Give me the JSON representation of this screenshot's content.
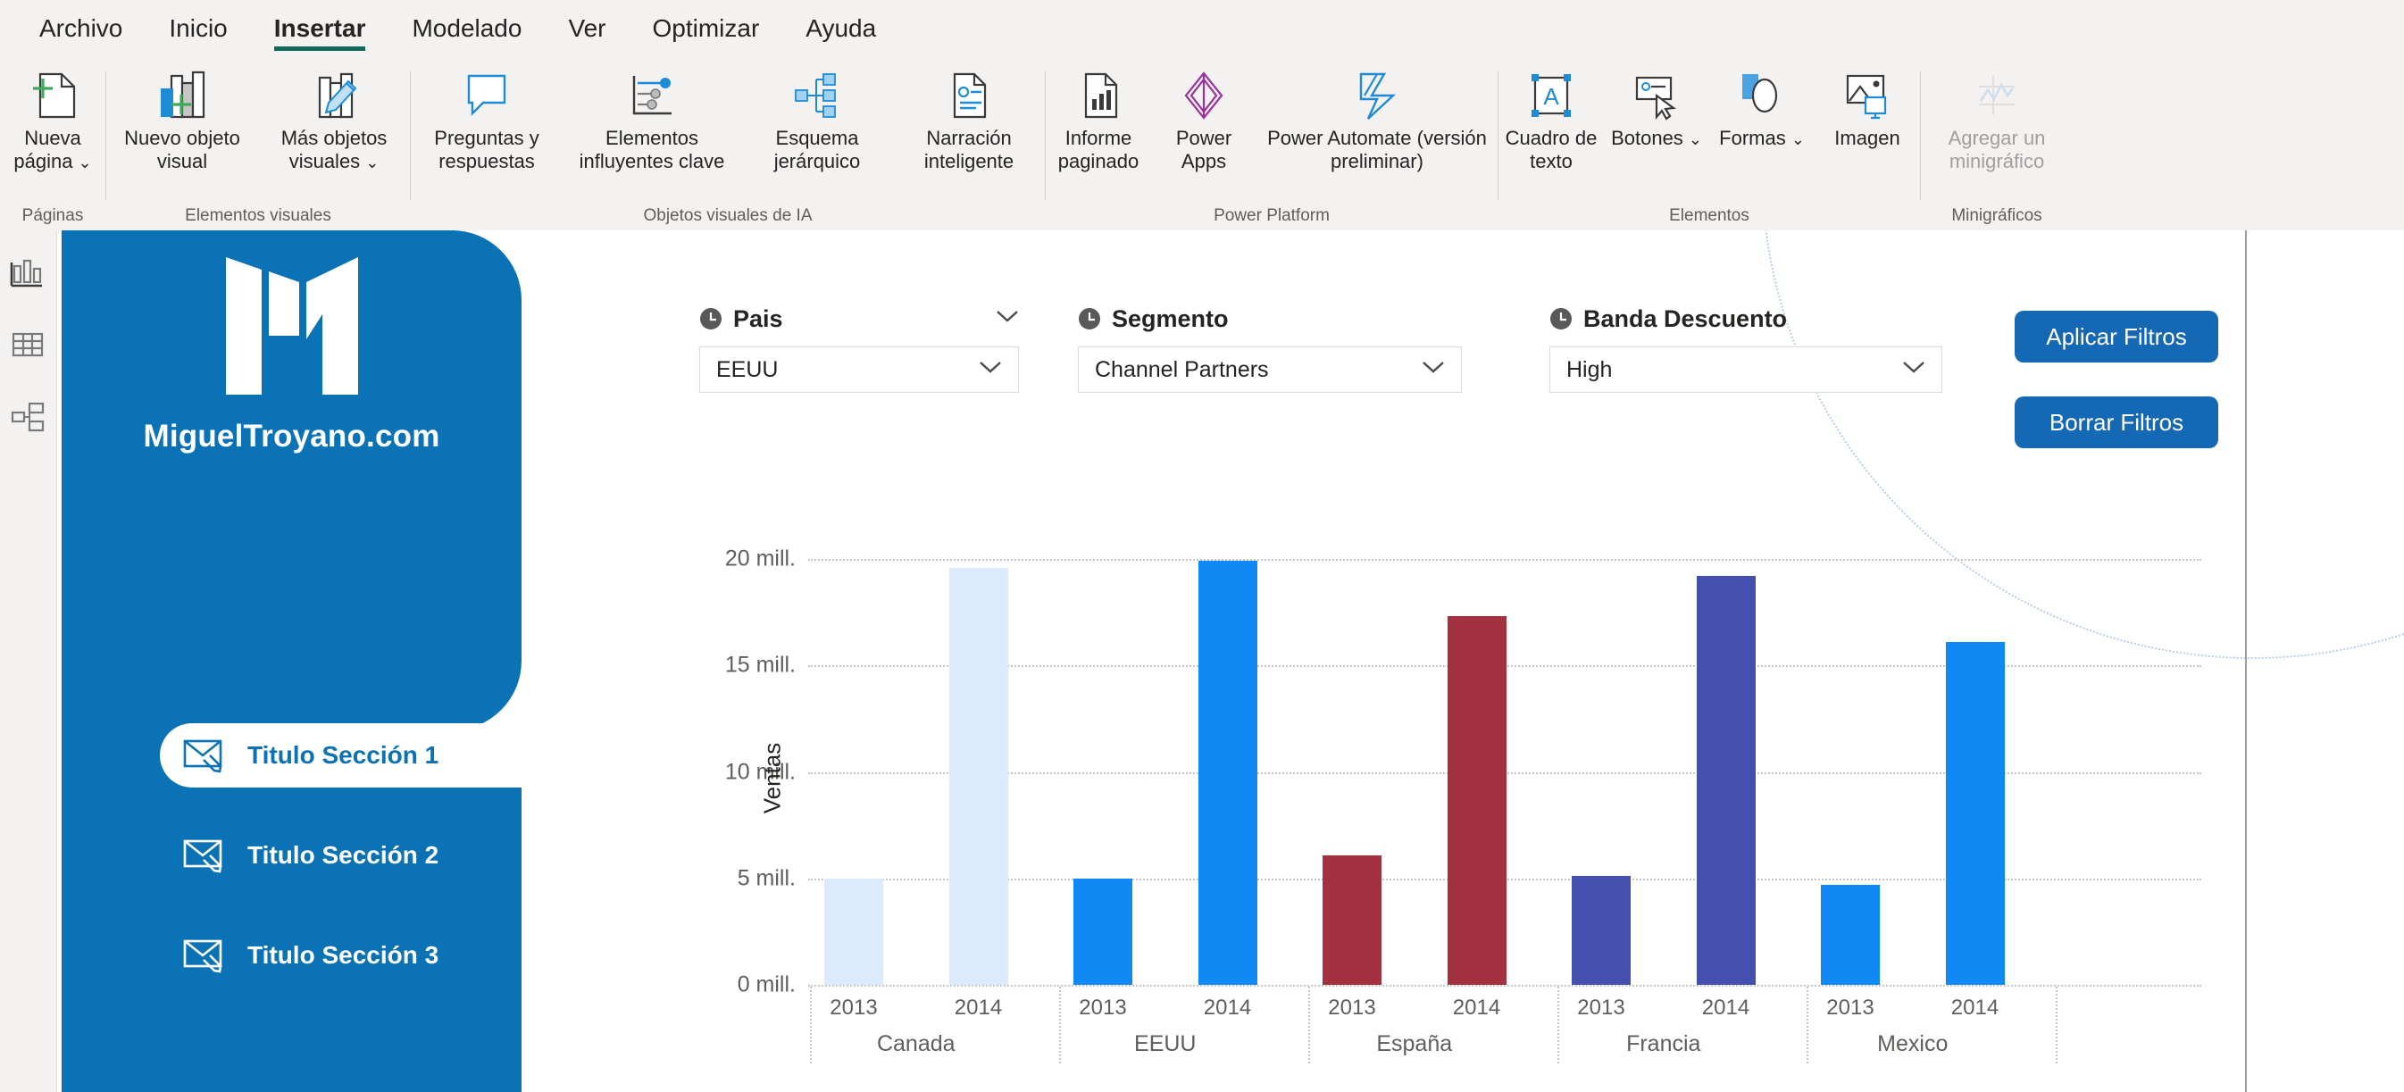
{
  "ribbon": {
    "tabs": [
      {
        "label": "Archivo",
        "active": false
      },
      {
        "label": "Inicio",
        "active": false
      },
      {
        "label": "Insertar",
        "active": true
      },
      {
        "label": "Modelado",
        "active": false
      },
      {
        "label": "Ver",
        "active": false
      },
      {
        "label": "Optimizar",
        "active": false
      },
      {
        "label": "Ayuda",
        "active": false
      }
    ],
    "groups": [
      {
        "label": "Páginas",
        "commands": [
          {
            "label": "Nueva página",
            "icon": "new-page-icon",
            "chevron": true,
            "size": "normal",
            "disabled": false
          }
        ]
      },
      {
        "label": "Elementos visuales",
        "commands": [
          {
            "label": "Nuevo objeto visual",
            "icon": "new-visual-icon",
            "chevron": false,
            "size": "wide",
            "disabled": false
          },
          {
            "label": "Más objetos visuales",
            "icon": "more-visuals-icon",
            "chevron": true,
            "size": "wide",
            "disabled": false
          }
        ]
      },
      {
        "label": "Objetos visuales de IA",
        "commands": [
          {
            "label": "Preguntas y respuestas",
            "icon": "qna-icon",
            "chevron": false,
            "size": "wide",
            "disabled": false
          },
          {
            "label": "Elementos influyentes clave",
            "icon": "key-influencers-icon",
            "chevron": false,
            "size": "wide2",
            "disabled": false
          },
          {
            "label": "Esquema jerárquico",
            "icon": "decomposition-tree-icon",
            "chevron": false,
            "size": "wide",
            "disabled": false
          },
          {
            "label": "Narración inteligente",
            "icon": "smart-narrative-icon",
            "chevron": false,
            "size": "wide",
            "disabled": false
          }
        ]
      },
      {
        "label": "Power Platform",
        "commands": [
          {
            "label": "Informe paginado",
            "icon": "paginated-report-icon",
            "chevron": false,
            "size": "normal",
            "disabled": false
          },
          {
            "label": "Power Apps",
            "icon": "power-apps-icon",
            "chevron": false,
            "size": "normal",
            "disabled": false
          },
          {
            "label": "Power Automate (versión preliminar)",
            "icon": "power-automate-icon",
            "chevron": false,
            "size": "xwide",
            "disabled": false
          }
        ]
      },
      {
        "label": "Elementos",
        "commands": [
          {
            "label": "Cuadro de texto",
            "icon": "text-box-icon",
            "chevron": false,
            "size": "normal",
            "disabled": false
          },
          {
            "label": "Botones",
            "icon": "buttons-icon",
            "chevron": true,
            "size": "normal",
            "disabled": false
          },
          {
            "label": "Formas",
            "icon": "shapes-icon",
            "chevron": true,
            "size": "normal",
            "disabled": false
          },
          {
            "label": "Imagen",
            "icon": "image-icon",
            "chevron": false,
            "size": "normal",
            "disabled": false
          }
        ]
      },
      {
        "label": "Minigráficos",
        "commands": [
          {
            "label": "Agregar un minigráfico",
            "icon": "sparkline-icon",
            "chevron": false,
            "size": "wide",
            "disabled": true
          }
        ]
      }
    ]
  },
  "rail": {
    "items": [
      {
        "icon": "report-view-icon",
        "name": "report-view"
      },
      {
        "icon": "table-view-icon",
        "name": "table-view"
      },
      {
        "icon": "model-view-icon",
        "name": "model-view"
      }
    ]
  },
  "sidebar": {
    "brand": "MiguelTroyano.com",
    "logo_icon": "m-monogram-logo",
    "items": [
      {
        "label": "Titulo Sección 1",
        "icon": "envelope-pencil-icon",
        "active": true
      },
      {
        "label": "Titulo Sección 2",
        "icon": "envelope-pencil-icon",
        "active": false
      },
      {
        "label": "Titulo Sección 3",
        "icon": "envelope-pencil-icon",
        "active": false
      }
    ]
  },
  "slicers": [
    {
      "title": "Pais",
      "value": "EEUU",
      "icon": "clock-icon",
      "has_expand": true
    },
    {
      "title": "Segmento",
      "value": "Channel Partners",
      "icon": "clock-icon",
      "has_expand": false
    },
    {
      "title": "Banda Descuento",
      "value": "High",
      "icon": "clock-icon",
      "has_expand": false
    }
  ],
  "buttons": {
    "apply": "Aplicar Filtros",
    "clear": "Borrar Filtros",
    "color": "#1569b4"
  },
  "chart_data": {
    "type": "bar",
    "title": "",
    "xlabel": "",
    "ylabel": "Ventas",
    "ylim": [
      0,
      20000000
    ],
    "grid": true,
    "legend": "none",
    "ytick_labels": [
      "0 mill.",
      "5 mill.",
      "10 mill.",
      "15 mill.",
      "20 mill."
    ],
    "ytick_values": [
      0,
      5000000,
      10000000,
      15000000,
      20000000
    ],
    "groups": [
      "Canada",
      "EEUU",
      "España",
      "Francia",
      "Mexico"
    ],
    "subcategories": [
      "2013",
      "2014"
    ],
    "bars": [
      {
        "group": "Canada",
        "year": "2013",
        "value": 5000000,
        "color": "#dbeafd"
      },
      {
        "group": "Canada",
        "year": "2014",
        "value": 19600000,
        "color": "#dbeafd"
      },
      {
        "group": "EEUU",
        "year": "2013",
        "value": 5000000,
        "color": "#1189f5"
      },
      {
        "group": "EEUU",
        "year": "2014",
        "value": 19900000,
        "color": "#1189f5"
      },
      {
        "group": "España",
        "year": "2013",
        "value": 6100000,
        "color": "#a3313f"
      },
      {
        "group": "España",
        "year": "2014",
        "value": 17300000,
        "color": "#a3313f"
      },
      {
        "group": "Francia",
        "year": "2013",
        "value": 5100000,
        "color": "#4450ae"
      },
      {
        "group": "Francia",
        "year": "2014",
        "value": 19200000,
        "color": "#4450ae"
      },
      {
        "group": "Mexico",
        "year": "2013",
        "value": 4700000,
        "color": "#1189f5"
      },
      {
        "group": "Mexico",
        "year": "2014",
        "value": 16100000,
        "color": "#1189f5"
      }
    ]
  }
}
